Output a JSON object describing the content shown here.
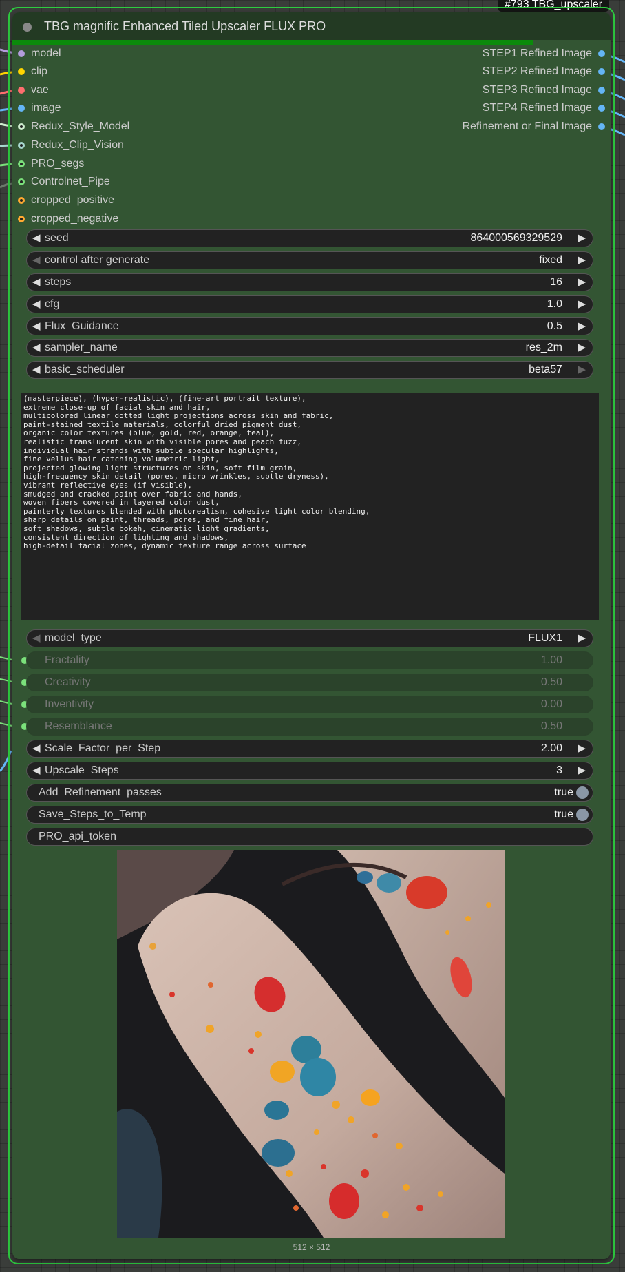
{
  "node": {
    "id_label": "#793 TBG_upscaler",
    "title": "TBG magnific Enhanced Tiled Upscaler FLUX PRO",
    "progress_percent": 87
  },
  "inputs": [
    {
      "label": "model",
      "color": "#b39ddb"
    },
    {
      "label": "clip",
      "color": "#ffd500"
    },
    {
      "label": "vae",
      "color": "#ff6e6e"
    },
    {
      "label": "image",
      "color": "#64b5f6"
    },
    {
      "label": "Redux_Style_Model",
      "color": "#cfeecf"
    },
    {
      "label": "Redux_Clip_Vision",
      "color": "#a8d8d0"
    },
    {
      "label": "PRO_segs",
      "color": "#7be07b"
    },
    {
      "label": "Controlnet_Pipe",
      "color": "#7be07b"
    },
    {
      "label": "cropped_positive",
      "color": "#ffa931"
    },
    {
      "label": "cropped_negative",
      "color": "#ffa931"
    }
  ],
  "outputs": [
    {
      "label": "STEP1 Refined Image",
      "color": "#64b5f6"
    },
    {
      "label": "STEP2 Refined Image",
      "color": "#64b5f6"
    },
    {
      "label": "STEP3 Refined Image",
      "color": "#64b5f6"
    },
    {
      "label": "STEP4 Refined Image",
      "color": "#64b5f6"
    },
    {
      "label": "Refinement or Final Image",
      "color": "#64b5f6"
    }
  ],
  "widgets": {
    "seed": {
      "name": "seed",
      "value": "864000569329529"
    },
    "control_after_generate": {
      "name": "control after generate",
      "value": "fixed"
    },
    "steps": {
      "name": "steps",
      "value": "16"
    },
    "cfg": {
      "name": "cfg",
      "value": "1.0"
    },
    "flux_guidance": {
      "name": "Flux_Guidance",
      "value": "0.5"
    },
    "sampler_name": {
      "name": "sampler_name",
      "value": "res_2m"
    },
    "basic_scheduler": {
      "name": "basic_scheduler",
      "value": "beta57"
    },
    "model_type": {
      "name": "model_type",
      "value": "FLUX1"
    },
    "fractality": {
      "name": "Fractality",
      "value": "1.00"
    },
    "creativity": {
      "name": "Creativity",
      "value": "0.50"
    },
    "inventivity": {
      "name": "Inventivity",
      "value": "0.00"
    },
    "resemblance": {
      "name": "Resemblance",
      "value": "0.50"
    },
    "scale_factor": {
      "name": "Scale_Factor_per_Step",
      "value": "2.00"
    },
    "upscale_steps": {
      "name": "Upscale_Steps",
      "value": "3"
    },
    "add_refinement": {
      "name": "Add_Refinement_passes",
      "value": "true"
    },
    "save_steps": {
      "name": "Save_Steps_to_Temp",
      "value": "true"
    },
    "pro_api_token": {
      "name": "PRO_api_token",
      "value": ""
    }
  },
  "prompt_text": "(masterpiece), (hyper-realistic), (fine-art portrait texture),\nextreme close-up of facial skin and hair,\nmulticolored linear dotted light projections across skin and fabric,\npaint-stained textile materials, colorful dried pigment dust,\norganic color textures (blue, gold, red, orange, teal),\nrealistic translucent skin with visible pores and peach fuzz,\nindividual hair strands with subtle specular highlights,\nfine vellus hair catching volumetric light,\nprojected glowing light structures on skin, soft film grain,\nhigh-frequency skin detail (pores, micro wrinkles, subtle dryness),\nvibrant reflective eyes (if visible),\nsmudged and cracked paint over fabric and hands,\nwoven fibers covered in layered color dust,\npainterly textures blended with photorealism, cohesive light color blending,\nsharp details on paint, threads, pores, and fine hair,\nsoft shadows, subtle bokeh, cinematic light gradients,\nconsistent direction of lighting and shadows,\nhigh-detail facial zones, dynamic texture range across surface",
  "preview": {
    "size_label": "512 × 512"
  }
}
